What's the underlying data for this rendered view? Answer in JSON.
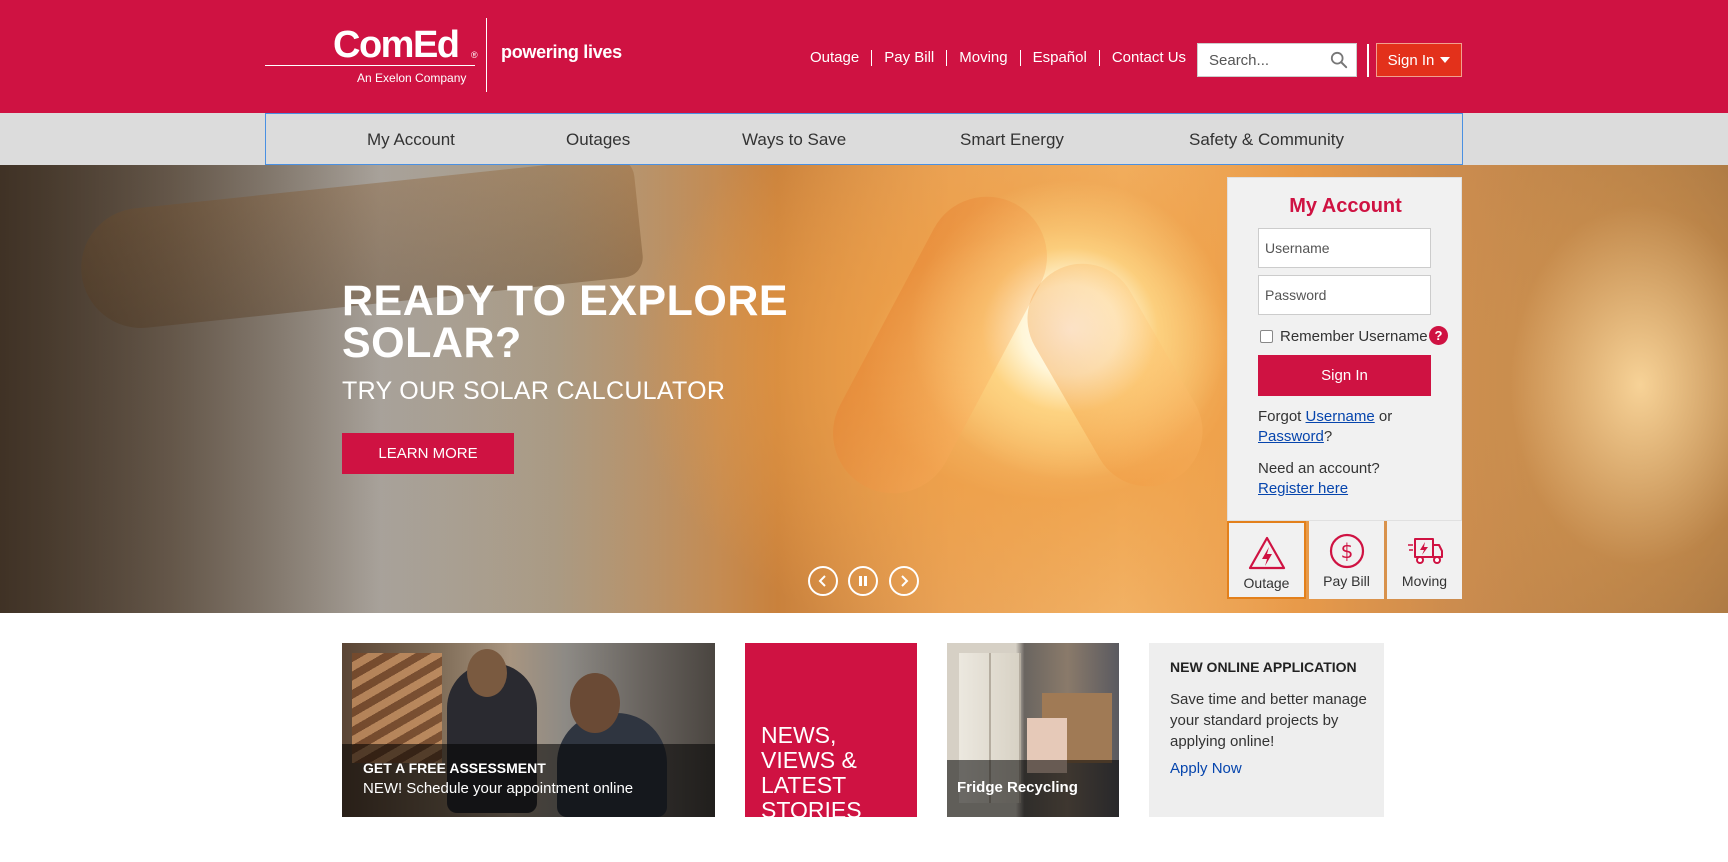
{
  "brand": {
    "logo": "ComEd",
    "logo_mark": "®",
    "logo_sub": "An Exelon Company",
    "tagline": "powering lives",
    "accent_color": "#cf1242",
    "signin_color": "#e3311b",
    "link_color": "#0645ad"
  },
  "utility_nav": [
    "Outage",
    "Pay Bill",
    "Moving",
    "Español",
    "Contact Us"
  ],
  "search": {
    "placeholder": "Search...",
    "icon": "search-icon"
  },
  "header_signin": {
    "label": "Sign In",
    "icon": "caret-down-icon"
  },
  "main_nav": [
    "My Account",
    "Outages",
    "Ways to Save",
    "Smart Energy",
    "Safety & Community"
  ],
  "hero": {
    "title": "READY TO EXPLORE SOLAR?",
    "subtitle": "TRY OUR SOLAR CALCULATOR",
    "button": "LEARN MORE",
    "controls": [
      "chevron-left-icon",
      "pause-icon",
      "chevron-right-icon"
    ]
  },
  "login": {
    "title": "My Account",
    "username_placeholder": "Username",
    "password_placeholder": "Password",
    "remember_label": "Remember Username",
    "help_icon": "?",
    "signin_button": "Sign In",
    "forgot_prefix": "Forgot",
    "forgot_username": "Username",
    "forgot_or": "or",
    "forgot_password": "Password",
    "forgot_suffix": "?",
    "need_account": "Need an account?",
    "register_link": "Register here"
  },
  "quick_links": [
    {
      "label": "Outage",
      "icon": "outage-warning-icon",
      "active": true
    },
    {
      "label": "Pay Bill",
      "icon": "dollar-icon",
      "active": false
    },
    {
      "label": "Moving",
      "icon": "truck-icon",
      "active": false
    }
  ],
  "cards": {
    "assessment": {
      "title": "GET A FREE ASSESSMENT",
      "subtitle": "NEW! Schedule your appointment online"
    },
    "news": {
      "title": "NEWS, VIEWS & LATEST STORIES"
    },
    "fridge": {
      "title": "Fridge Recycling"
    },
    "application": {
      "title": "NEW ONLINE APPLICATION",
      "body": "Save time and better manage your standard projects by applying online!",
      "link": "Apply Now"
    }
  }
}
